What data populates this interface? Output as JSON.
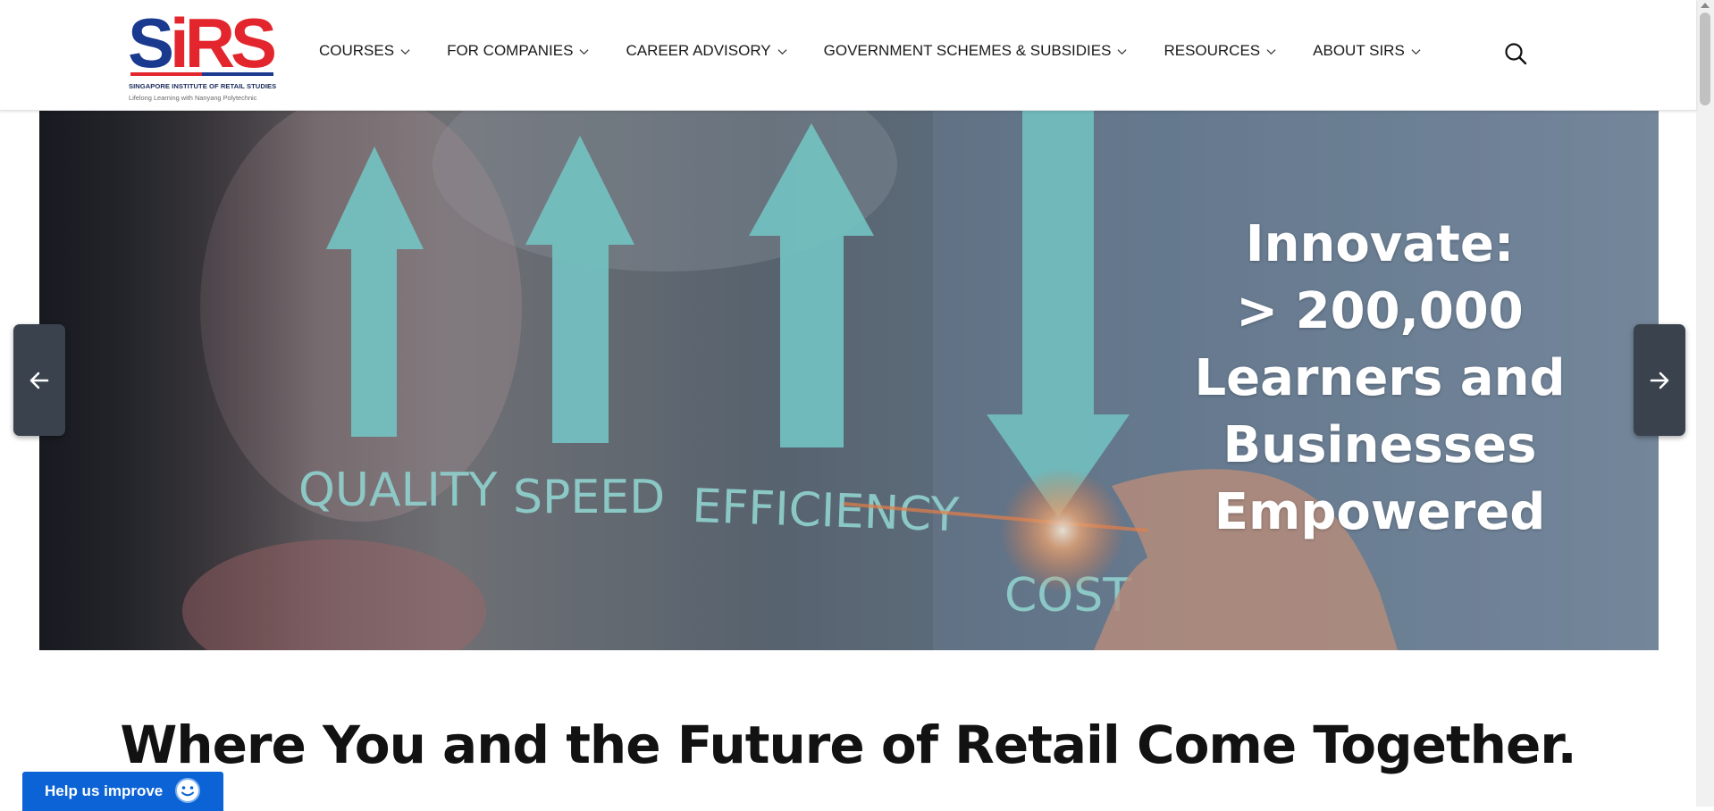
{
  "header": {
    "logo": {
      "mark_blue_s": "S",
      "mark_red": "iRS",
      "name": "SINGAPORE INSTITUTE OF RETAIL STUDIES",
      "tagline": "Lifelong Learning with Nanyang Polytechnic"
    },
    "nav": [
      {
        "label": "COURSES",
        "icon": "chevron-down-icon"
      },
      {
        "label": "FOR COMPANIES",
        "icon": "chevron-down-icon"
      },
      {
        "label": "CAREER ADVISORY",
        "icon": "chevron-down-icon"
      },
      {
        "label": "GOVERNMENT SCHEMES & SUBSIDIES",
        "icon": "chevron-down-icon"
      },
      {
        "label": "RESOURCES",
        "icon": "chevron-down-icon"
      },
      {
        "label": "ABOUT SIRS",
        "icon": "chevron-down-icon"
      }
    ],
    "search_icon": "search-icon"
  },
  "hero": {
    "image_labels": [
      "QUALITY",
      "SPEED",
      "EFFICIENCY",
      "COST"
    ],
    "lines": [
      "Innovate:",
      "> 200,000",
      "Learners and",
      "Businesses",
      "Empowered"
    ],
    "prev_icon": "arrow-left-icon",
    "next_icon": "arrow-right-icon"
  },
  "headline": "Where You and the Future of Retail Come Together.",
  "feedback": {
    "label": "Help us improve",
    "icon": "smiley-icon"
  },
  "colors": {
    "brand_blue": "#1a3a8f",
    "brand_red": "#e3262d",
    "feedback_blue": "#0b63d6",
    "arrow_bg": "#3a434d",
    "hero_accent_teal": "#7fd9d6"
  }
}
